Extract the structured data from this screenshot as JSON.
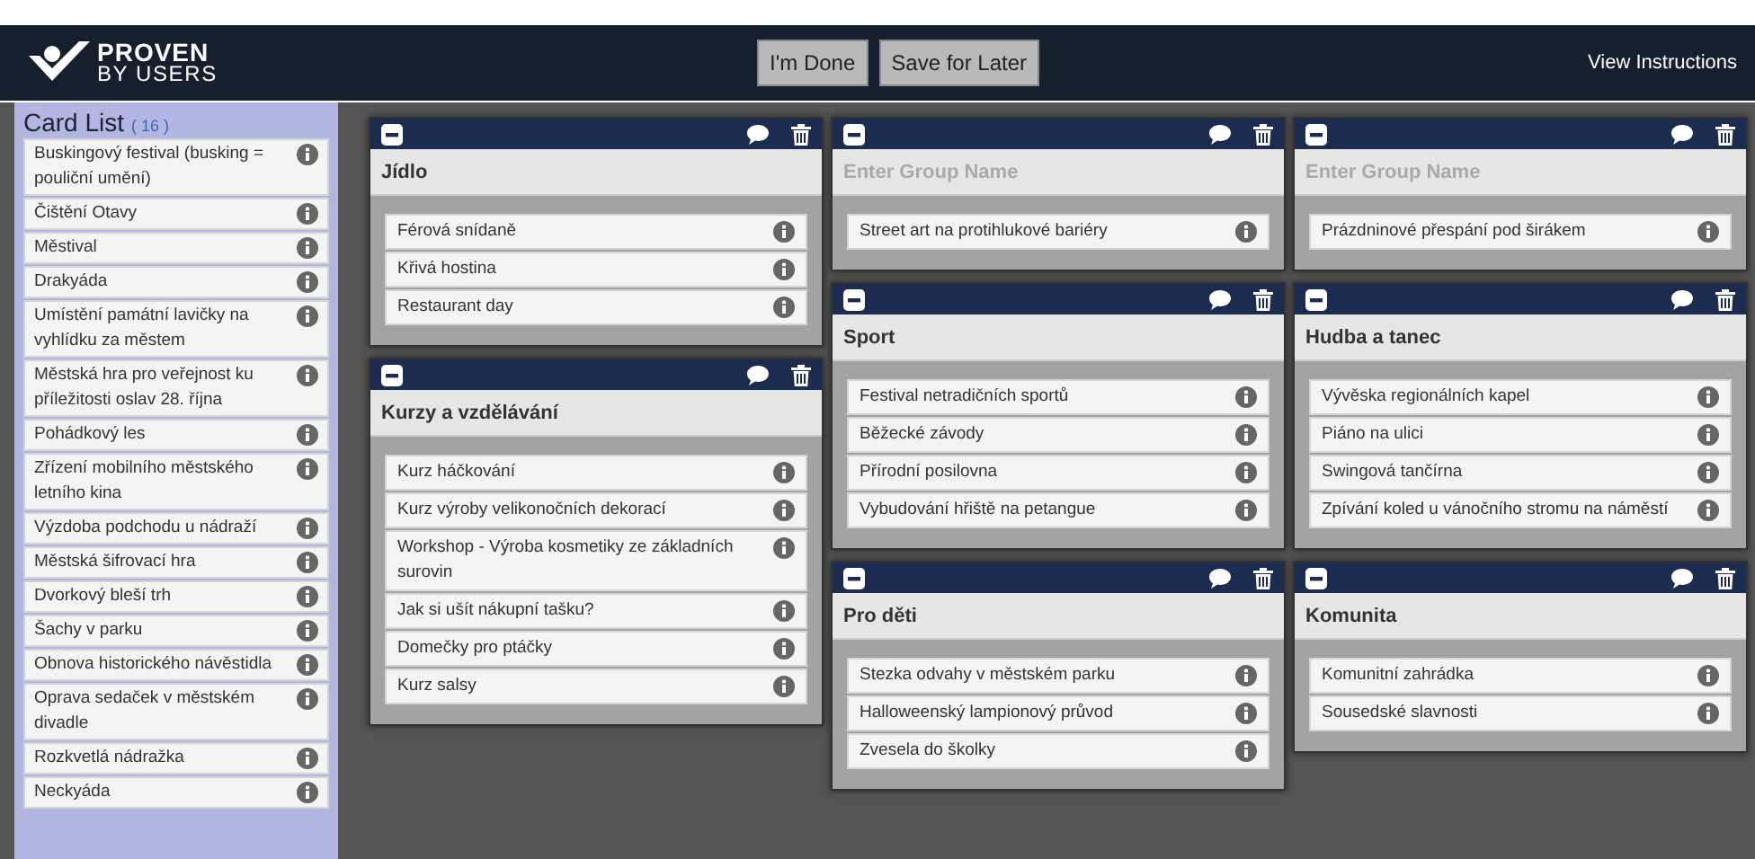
{
  "header": {
    "logo_line_1": "PROVEN",
    "logo_line_2": "BY USERS",
    "buttons": [
      "I'm Done",
      "Save for Later"
    ],
    "link": "View Instructions"
  },
  "card_list": {
    "title": "Card List",
    "count": "( 16 )",
    "cards": [
      "Buskingový festival (busking = pouliční umění)",
      "Čištění Otavy",
      "Městival",
      "Drakyáda",
      "Umístění památní lavičky na vyhlídku za městem",
      "Městská hra pro veřejnost ku příležitosti oslav 28. října",
      "Pohádkový les",
      "Zřízení mobilního městského letního kina",
      "Výzdoba podchodu u nádraží",
      "Městská šifrovací hra",
      "Dvorkový bleší trh",
      "Šachy v parku",
      "Obnova historického návěstidla",
      "Oprava sedaček v městském divadle",
      "Rozkvetlá nádražka",
      "Neckyáda"
    ]
  },
  "columns": [
    {
      "groups": [
        {
          "title": "Jídlo",
          "cards": [
            "Férová snídaně",
            "Křivá hostina",
            "Restaurant day"
          ]
        },
        {
          "title": "Kurzy a vzdělávání",
          "cards": [
            "Kurz háčkování",
            "Kurz výroby velikonočních dekorací",
            "Workshop - Výroba kosmetiky ze základních surovin",
            "Jak si ušít nákupní tašku?",
            "Domečky pro ptáčky",
            "Kurz salsy"
          ]
        }
      ]
    },
    {
      "groups": [
        {
          "placeholder": "Enter Group Name",
          "cards": [
            "Street art na protihlukové bariéry"
          ]
        },
        {
          "title": "Sport",
          "cards": [
            "Festival netradičních sportů",
            "Běžecké závody",
            "Přírodní posilovna",
            "Vybudování hřiště na petangue"
          ]
        },
        {
          "title": "Pro děti",
          "cards": [
            "Stezka odvahy v městském parku",
            "Halloweenský lampionový průvod",
            "Zvesela do školky"
          ]
        }
      ]
    },
    {
      "groups": [
        {
          "placeholder": "Enter Group Name",
          "cards": [
            "Prázdninové přespání pod širákem"
          ]
        },
        {
          "title": "Hudba a tanec",
          "cards": [
            "Vývěska regionálních kapel",
            "Piáno na ulici",
            "Swingová tančírna",
            "Zpívání koled u vánočního stromu na náměstí"
          ]
        },
        {
          "title": "Komunita",
          "cards": [
            "Komunitní zahrádka",
            "Sousedské slavnosti"
          ]
        }
      ]
    }
  ]
}
